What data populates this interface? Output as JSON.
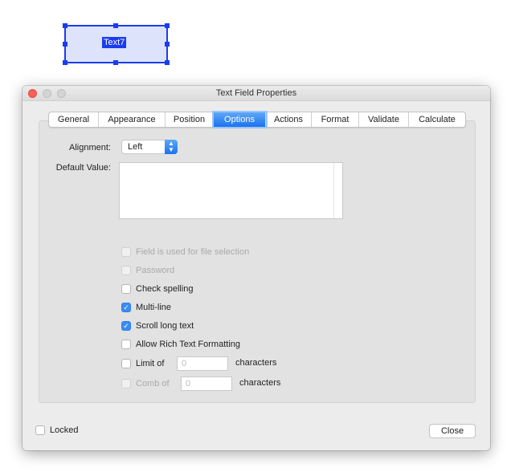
{
  "form_field": {
    "name": "Text7"
  },
  "window": {
    "title": "Text Field Properties"
  },
  "tabs": [
    {
      "label": "General",
      "w": 62
    },
    {
      "label": "Appearance",
      "w": 83
    },
    {
      "label": "Position",
      "w": 60
    },
    {
      "label": "Options",
      "w": 65,
      "selected": true
    },
    {
      "label": "Actions",
      "w": 57
    },
    {
      "label": "Format",
      "w": 59
    },
    {
      "label": "Validate",
      "w": 62
    },
    {
      "label": "Calculate",
      "w": 70
    }
  ],
  "options": {
    "alignment_label": "Alignment:",
    "alignment_value": "Left",
    "default_value_label": "Default Value:",
    "default_value": "",
    "checkboxes": [
      {
        "label": "Field is used for file selection",
        "checked": false,
        "disabled": true
      },
      {
        "label": "Password",
        "checked": false,
        "disabled": true
      },
      {
        "label": "Check spelling",
        "checked": false,
        "disabled": false
      },
      {
        "label": "Multi-line",
        "checked": true,
        "disabled": false
      },
      {
        "label": "Scroll long text",
        "checked": true,
        "disabled": false
      },
      {
        "label": "Allow Rich Text Formatting",
        "checked": false,
        "disabled": false
      },
      {
        "label": "Limit of",
        "checked": false,
        "disabled": false,
        "value": "0",
        "suffix": "characters"
      },
      {
        "label": "Comb of",
        "checked": false,
        "disabled": true,
        "value": "0",
        "suffix": "characters"
      }
    ]
  },
  "footer": {
    "locked_label": "Locked",
    "locked": false,
    "close_label": "Close"
  }
}
